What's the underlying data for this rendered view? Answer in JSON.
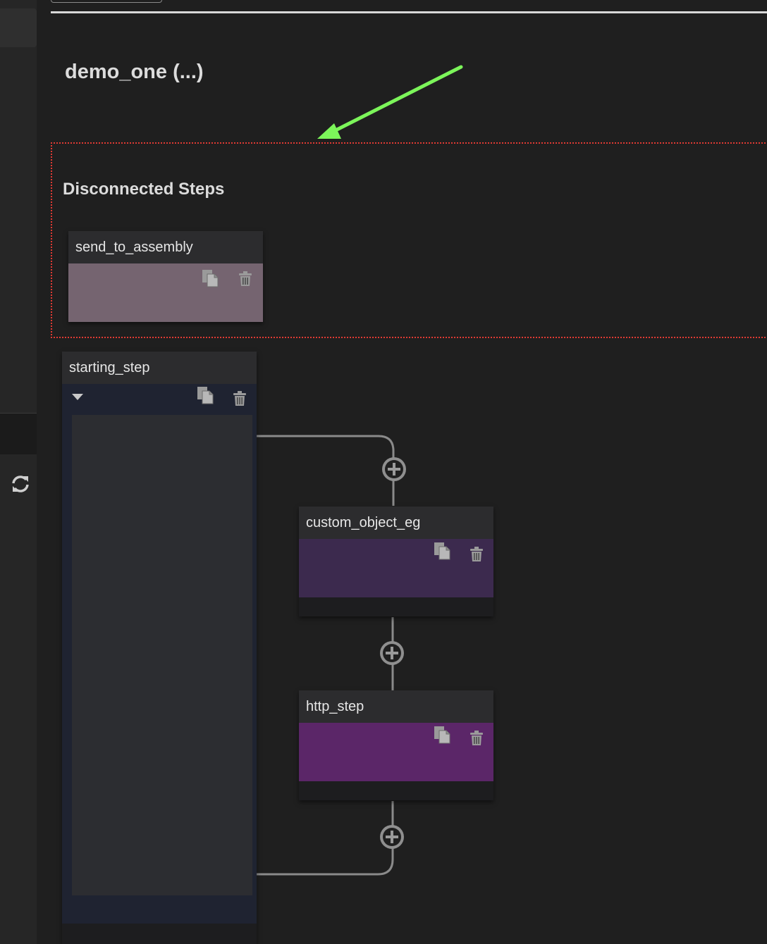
{
  "flow": {
    "title": "demo_one (...)"
  },
  "disconnected": {
    "title": "Disconnected Steps",
    "steps": [
      {
        "name": "send_to_assembly",
        "color": "#756470"
      }
    ]
  },
  "steps": [
    {
      "name": "starting_step",
      "color": "#1f2331"
    },
    {
      "name": "custom_object_eg",
      "color": "#3c2a4e"
    },
    {
      "name": "http_step",
      "color": "#5b2668"
    }
  ],
  "icons": {
    "refresh": "refresh-icon",
    "copy": "copy-icon",
    "delete": "trash-icon",
    "add": "plus-circle-icon",
    "collapse": "caret-down-icon",
    "annotation": "green-arrow"
  },
  "colors": {
    "background": "#1f1f1f",
    "annotation_arrow": "#7cf55a",
    "annotation_box": "#e03a33",
    "connector": "#8a8a8a"
  }
}
